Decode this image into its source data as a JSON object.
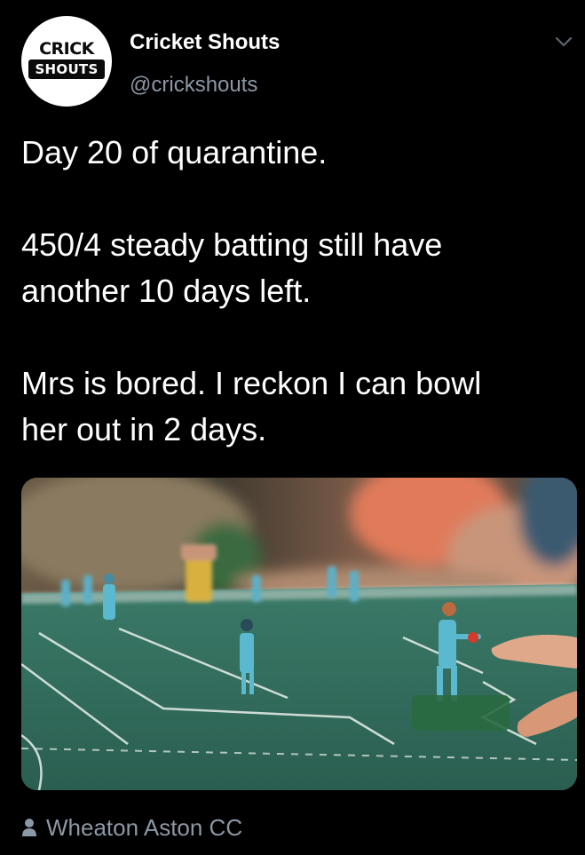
{
  "account": {
    "display_name": "Cricket Shouts",
    "handle": "@crickshouts",
    "avatar_logo_top": "CRICK",
    "avatar_logo_bottom": "SHOUTS"
  },
  "tweet": {
    "line1": "Day 20 of quarantine.",
    "line2a": "450/4 steady batting still have",
    "line2b": "another 10 days left.",
    "line3a": "Mrs is bored. I reckon I can bowl",
    "line3b": "her out in 2 days."
  },
  "location": {
    "label": "Wheaton Aston CC",
    "icon": "person-icon"
  },
  "icons": {
    "menu": "chevron-down-icon"
  },
  "colors": {
    "background": "#000000",
    "text": "#ffffff",
    "secondary_text": "#8b98a5",
    "pitch_green": "#2f6b5a"
  }
}
